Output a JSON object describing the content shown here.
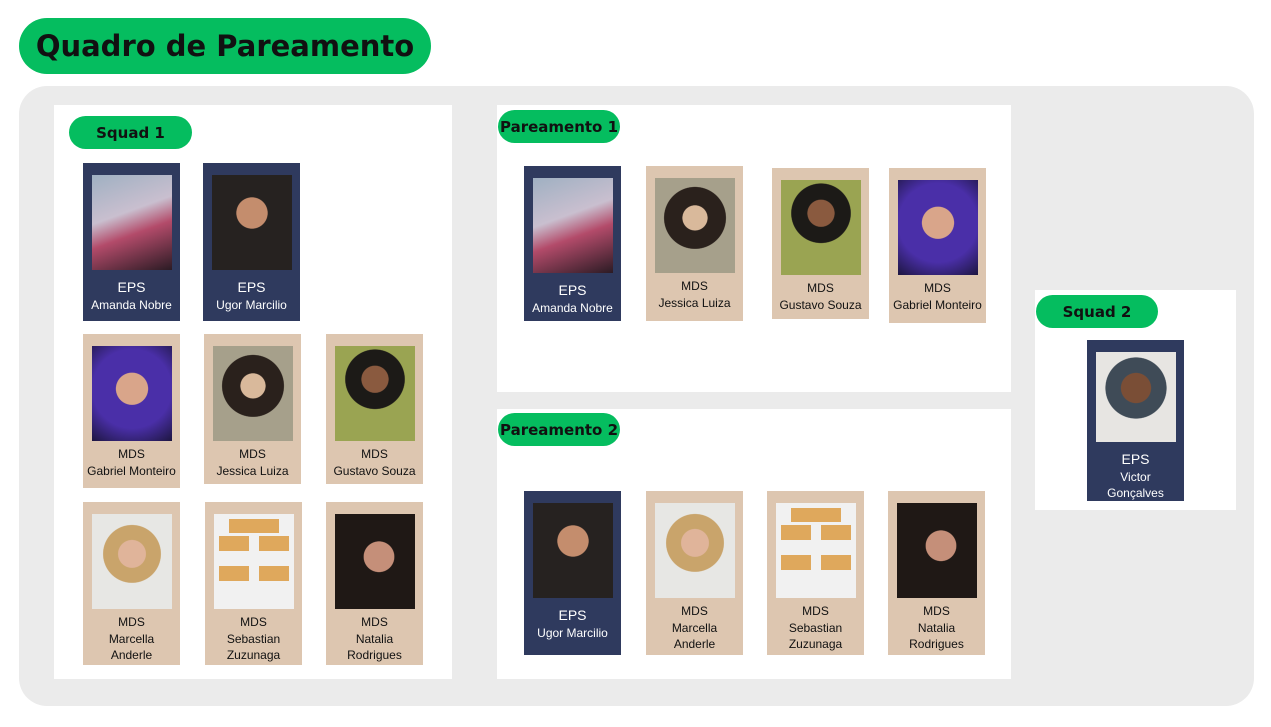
{
  "title": "Quadro de Pareamento",
  "squad1": {
    "label": "Squad 1",
    "members": [
      {
        "role": "EPS",
        "name": "Amanda Nobre"
      },
      {
        "role": "EPS",
        "name": "Ugor Marcilio"
      },
      {
        "role": "MDS",
        "name": "Gabriel Monteiro"
      },
      {
        "role": "MDS",
        "name": "Jessica Luiza"
      },
      {
        "role": "MDS",
        "name": "Gustavo Souza"
      },
      {
        "role": "MDS",
        "name": "Marcella Anderle"
      },
      {
        "role": "MDS",
        "name": "Sebastian Zuzunaga"
      },
      {
        "role": "MDS",
        "name": "Natalia Rodrigues"
      }
    ]
  },
  "pareamento1": {
    "label": "Pareamento 1",
    "members": [
      {
        "role": "EPS",
        "name": "Amanda Nobre"
      },
      {
        "role": "MDS",
        "name": "Jessica Luiza"
      },
      {
        "role": "MDS",
        "name": "Gustavo Souza"
      },
      {
        "role": "MDS",
        "name": "Gabriel Monteiro"
      }
    ]
  },
  "pareamento2": {
    "label": "Pareamento 2",
    "members": [
      {
        "role": "EPS",
        "name": "Ugor Marcilio"
      },
      {
        "role": "MDS",
        "name": "Marcella Anderle"
      },
      {
        "role": "MDS",
        "name": "Sebastian Zuzunaga"
      },
      {
        "role": "MDS",
        "name": "Natalia Rodrigues"
      }
    ]
  },
  "squad2": {
    "label": "Squad 2",
    "members": [
      {
        "role": "EPS",
        "name": "Victor Gonçalves"
      }
    ]
  },
  "colors": {
    "accent": "#05bd5f",
    "eps_card": "#2f3a5e",
    "mds_card": "#ddc6b0",
    "board": "#ebebeb"
  }
}
